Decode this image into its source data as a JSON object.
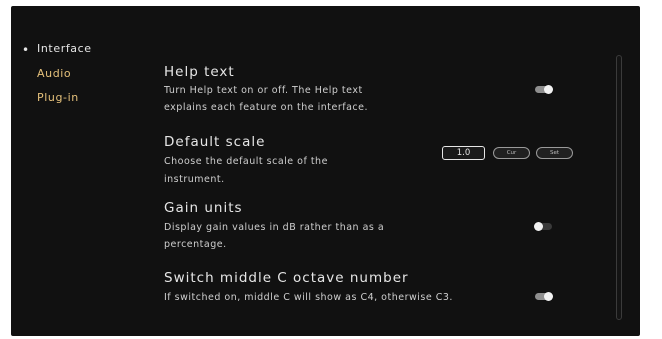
{
  "sidebar": {
    "bullet": "•",
    "items": [
      {
        "label": "Interface"
      },
      {
        "label": "Audio"
      },
      {
        "label": "Plug-in"
      }
    ]
  },
  "settings": {
    "help_text": {
      "title": "Help text",
      "description_line1": "Turn Help text on or off. The Help text",
      "description_line2": "explains each feature on the interface.",
      "enabled": true
    },
    "default_scale": {
      "title": "Default scale",
      "description_line1": "Choose the default scale of the",
      "description_line2": "instrument.",
      "value": "1.0",
      "button_left": "Cur",
      "button_right": "Set"
    },
    "gain_units": {
      "title": "Gain units",
      "description_line1": "Display gain values in dB rather than as a",
      "description_line2": "percentage.",
      "enabled": false
    },
    "middle_c": {
      "title": "Switch middle C octave number",
      "description": "If switched on, middle C will show as C4, otherwise C3.",
      "enabled": true
    }
  },
  "colors": {
    "background": "#111111",
    "sidebar_accent": "#e5c17b",
    "text_primary": "#e6e6e6",
    "text_secondary": "#cfcfcf"
  }
}
